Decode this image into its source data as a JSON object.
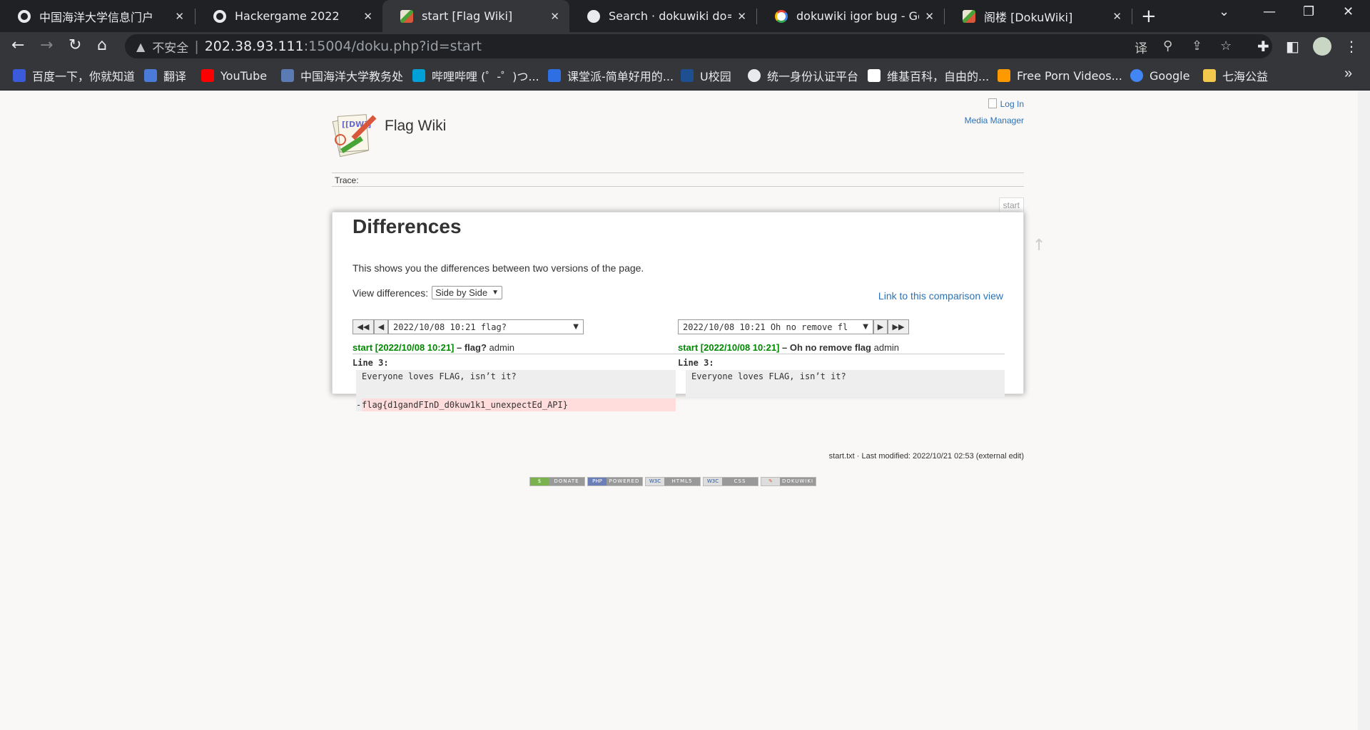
{
  "browser": {
    "tabs": [
      {
        "title": "中国海洋大学信息门户",
        "icon": "globe-icon"
      },
      {
        "title": "Hackergame 2022",
        "icon": "globe-icon"
      },
      {
        "title": "start [Flag Wiki]",
        "icon": "dokuwiki-icon"
      },
      {
        "title": "Search · dokuwiki do=diff",
        "icon": "github-icon"
      },
      {
        "title": "dokuwiki igor bug - Google",
        "icon": "google-icon"
      },
      {
        "title": "阁楼 [DokuWiki]",
        "icon": "dokuwiki-icon"
      }
    ],
    "active_tab_index": 2,
    "address": {
      "warning": "不安全",
      "host": "202.38.93.111",
      "rest": ":15004/doku.php?id=start"
    },
    "bookmarks": [
      {
        "label": "百度一下，你就知道",
        "color": "#3b5bdb"
      },
      {
        "label": "翻译",
        "color": "#4a7bd8"
      },
      {
        "label": "YouTube",
        "color": "#ff0000"
      },
      {
        "label": "中国海洋大学教务处",
        "color": "#5b7bb4"
      },
      {
        "label": "哔哩哔哩 (゜-゜)つ...",
        "color": "#00a1d6"
      },
      {
        "label": "课堂派-简单好用的...",
        "color": "#2f6fe4"
      },
      {
        "label": "U校园",
        "color": "#1d4f91"
      },
      {
        "label": "统一身份认证平台",
        "color": "#e8eaed"
      },
      {
        "label": "维基百科，自由的...",
        "color": "#ffffff"
      },
      {
        "label": "Free Porn Videos...",
        "color": "#ff9900"
      },
      {
        "label": "Google",
        "color": "#4285f4"
      },
      {
        "label": "七海公益",
        "color": "#f2c94c"
      }
    ]
  },
  "wiki": {
    "site_title": "Flag Wiki",
    "login": "Log In",
    "media_manager": "Media Manager",
    "trace": "Trace:",
    "page_id": "start",
    "heading": "Differences",
    "description": "This shows you the differences between two versions of the page.",
    "view_diff_label": "View differences:",
    "view_diff_value": "Side by Side",
    "comparison_link": "Link to this comparison view",
    "left_select": "2022/10/08 10:21 flag?",
    "right_select": "2022/10/08 10:21 Oh no remove fl",
    "left_rev": {
      "link": "start [2022/10/08 10:21]",
      "summary": "– flag?",
      "user": "admin"
    },
    "right_rev": {
      "link": "start [2022/10/08 10:21]",
      "summary": "– Oh no remove flag",
      "user": "admin"
    },
    "line_label": "Line 3:",
    "context_line": "Everyone loves FLAG, isn’t it?",
    "deleted_marker": "-",
    "deleted_line": "flag{d1gandFInD_d0kuw1k1_unexpectEd_API}",
    "docinfo": "start.txt · Last modified: 2022/10/21 02:53 (external edit)",
    "badges": [
      "DONATE",
      "POWERED",
      "HTML5",
      "CSS",
      "DOKUWIKI"
    ]
  }
}
